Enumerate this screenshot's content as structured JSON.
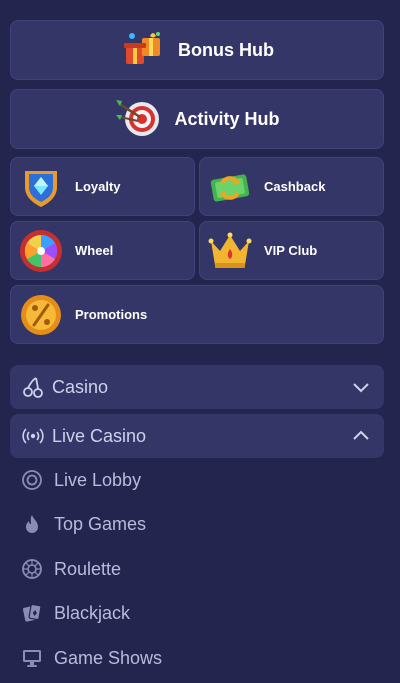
{
  "hubs": {
    "bonus": {
      "label": "Bonus Hub",
      "icon": "gift-boxes-icon"
    },
    "activity": {
      "label": "Activity Hub",
      "icon": "dart-target-icon"
    }
  },
  "tiles": {
    "loyalty": {
      "label": "Loyalty",
      "icon": "shield-gem-icon"
    },
    "cashback": {
      "label": "Cashback",
      "icon": "cash-refresh-icon"
    },
    "wheel": {
      "label": "Wheel",
      "icon": "prize-wheel-icon"
    },
    "vip": {
      "label": "VIP Club",
      "icon": "crown-icon"
    },
    "promotions": {
      "label": "Promotions",
      "icon": "percent-coin-icon"
    }
  },
  "menu": {
    "casino": {
      "label": "Casino",
      "icon": "cherries-icon",
      "expanded": false
    },
    "live_casino": {
      "label": "Live Casino",
      "icon": "broadcast-icon",
      "expanded": true
    },
    "live_items": [
      {
        "label": "Live Lobby",
        "icon": "lobby-circle-icon"
      },
      {
        "label": "Top Games",
        "icon": "flame-icon"
      },
      {
        "label": "Roulette",
        "icon": "roulette-icon"
      },
      {
        "label": "Blackjack",
        "icon": "cards-icon"
      },
      {
        "label": "Game Shows",
        "icon": "monitor-icon"
      }
    ]
  },
  "colors": {
    "background": "#24254f",
    "card": "#343668",
    "text": "#ffffff",
    "muted_text": "#b9bbdc"
  }
}
